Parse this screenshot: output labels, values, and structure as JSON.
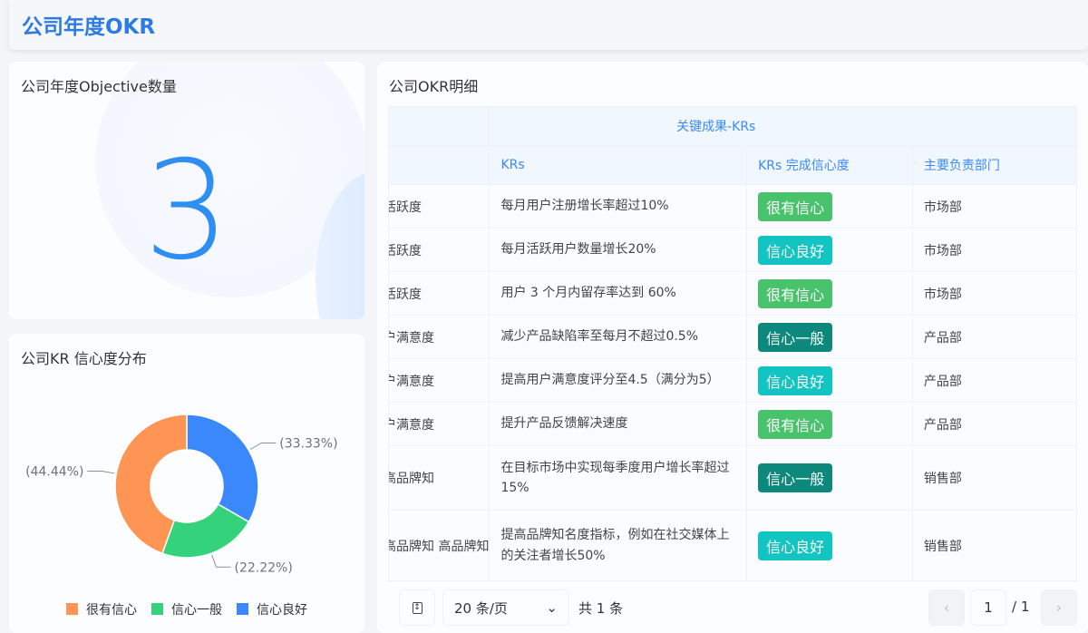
{
  "header": {
    "title": "公司年度OKR"
  },
  "objective_card": {
    "title": "公司年度Objective数量",
    "value": "3"
  },
  "kr_chart_card": {
    "title": "公司KR 信心度分布"
  },
  "chart_data": {
    "type": "pie",
    "donut": true,
    "categories": [
      "很有信心",
      "信心一般",
      "信心良好"
    ],
    "values": [
      44.44,
      22.22,
      33.33
    ],
    "labels": [
      "(44.44%)",
      "(22.22%)",
      "(33.33%)"
    ],
    "colors": [
      "#ff9555",
      "#34d27b",
      "#3b88fd"
    ],
    "legend": "bottom"
  },
  "detail_card": {
    "title": "公司OKR明细",
    "group_header": "关键成果-KRs",
    "columns": [
      "KRs",
      "KRs 完成信心度",
      "主要负责部门"
    ],
    "rows": [
      {
        "obj": "活跃度",
        "kr": "每月用户注册增长率超过10%",
        "conf": "很有信心",
        "dept": "市场部"
      },
      {
        "obj": "活跃度",
        "kr": "每月活跃用户数量增长20%",
        "conf": "信心良好",
        "dept": "市场部"
      },
      {
        "obj": "活跃度",
        "kr": "用户 3 个月内留存率达到 60%",
        "conf": "很有信心",
        "dept": "市场部"
      },
      {
        "obj": "户满意度",
        "kr": "减少产品缺陷率至每月不超过0.5%",
        "conf": "信心一般",
        "dept": "产品部"
      },
      {
        "obj": "户满意度",
        "kr": "提高用户满意度评分至4.5（满分为5）",
        "conf": "信心良好",
        "dept": "产品部"
      },
      {
        "obj": "户满意度",
        "kr": "提升产品反馈解决速度",
        "conf": "很有信心",
        "dept": "产品部"
      },
      {
        "obj": "高品牌知",
        "kr": "在目标市场中实现每季度用户增长率超过15%",
        "conf": "信心一般",
        "dept": "销售部"
      },
      {
        "obj": "高品牌知 高品牌知",
        "kr": "提高品牌知名度指标，例如在社交媒体上的关注者增长50%",
        "conf": "信心良好",
        "dept": "销售部"
      }
    ],
    "badge_colors": {
      "很有信心": "#48c26b",
      "信心良好": "#12c5c3",
      "信心一般": "#0d887c"
    }
  },
  "pagination": {
    "page_size": "20 条/页",
    "total": "共 1 条",
    "current": "1",
    "pages": "/ 1"
  }
}
